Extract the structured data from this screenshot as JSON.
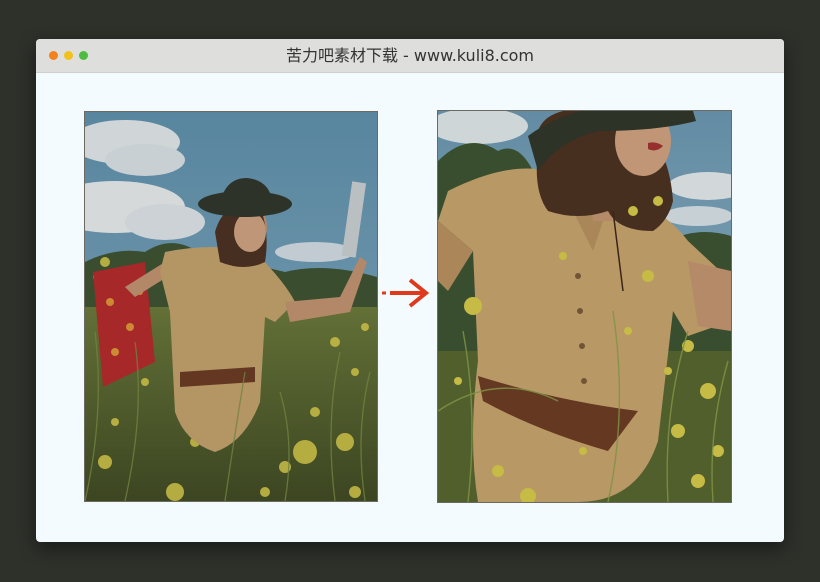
{
  "window": {
    "title": "苦力吧素材下载 - www.kuli8.com",
    "controls": [
      {
        "name": "close",
        "color": "#f1821e"
      },
      {
        "name": "minimize",
        "color": "#f2c21a"
      },
      {
        "name": "maximize",
        "color": "#4dbd3f"
      }
    ]
  },
  "images": {
    "before": {
      "icon": "photo-original"
    },
    "after": {
      "icon": "photo-zoomed"
    }
  },
  "arrow": {
    "icon": "arrow-right-icon",
    "color": "#e03a1c"
  }
}
